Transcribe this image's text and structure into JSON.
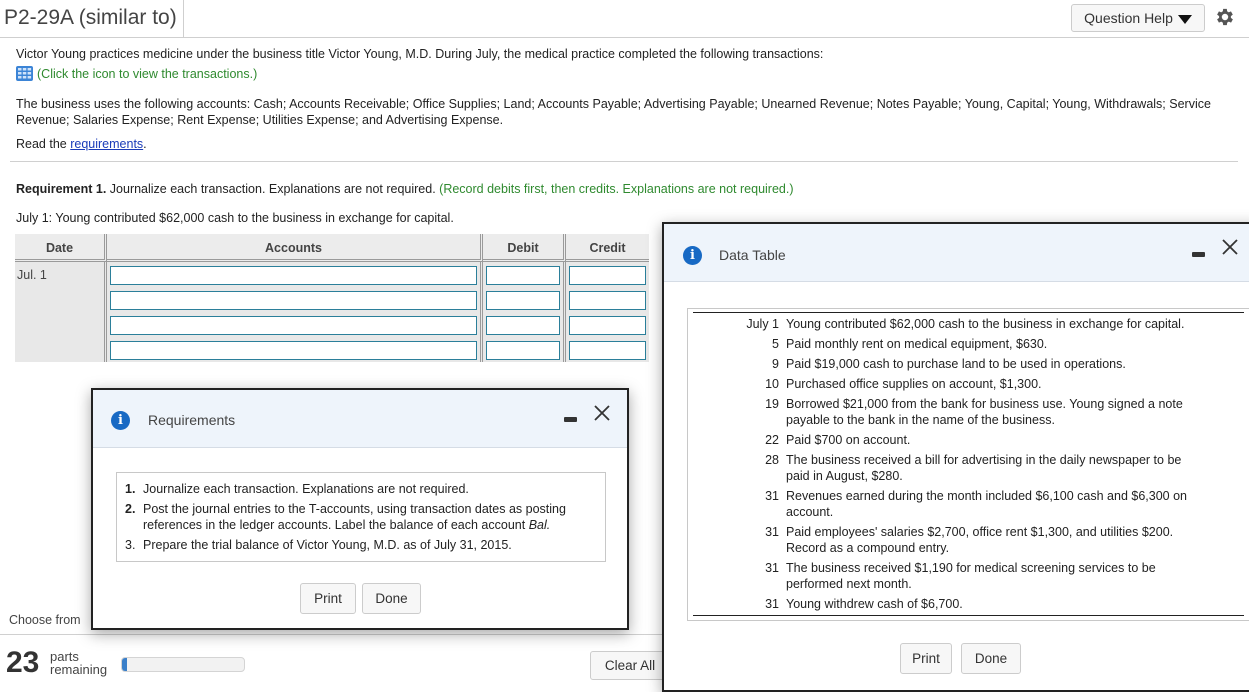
{
  "header": {
    "title": "P2-29A (similar to)",
    "question_help_label": "Question Help",
    "gear_icon": "gear-icon"
  },
  "intro": {
    "line1": "Victor Young practices medicine under the business title Victor Young, M.D. During July, the medical practice completed the following transactions:",
    "transactions_link": "(Click the icon to view the transactions.)",
    "accounts_text": "The business uses the following accounts: Cash; Accounts Receivable; Office Supplies; Land; Accounts Payable; Advertising Payable; Unearned Revenue; Notes Payable; Young, Capital; Young, Withdrawals; Service Revenue; Salaries Expense; Rent Expense; Utilities Expense; and Advertising Expense.",
    "read_prefix": "Read the ",
    "requirements_link": "requirements",
    "read_suffix": "."
  },
  "requirement1": {
    "label": "Requirement 1.",
    "text": " Journalize each transaction. Explanations are not required. ",
    "hint": "(Record debits first, then credits. Explanations are not required.)",
    "transaction": "July 1: Young contributed $62,000 cash to the business in exchange for capital."
  },
  "journal": {
    "headers": [
      "Date",
      "Accounts",
      "Debit",
      "Credit"
    ],
    "date": "Jul. 1",
    "rows": [
      {
        "account": "",
        "debit": "",
        "credit": ""
      },
      {
        "account": "",
        "debit": "",
        "credit": ""
      },
      {
        "account": "",
        "debit": "",
        "credit": ""
      },
      {
        "account": "",
        "debit": "",
        "credit": ""
      }
    ]
  },
  "footer": {
    "choose_from": "Choose from",
    "parts_count": "23",
    "parts_label_1": "parts",
    "parts_label_2": "remaining",
    "progress_fraction": 0.04,
    "clear_all_label": "Clear All"
  },
  "requirements_modal": {
    "title": "Requirements",
    "items": [
      {
        "num": "1.",
        "text": "Journalize each transaction. Explanations are not required."
      },
      {
        "num": "2.",
        "text": "Post the journal entries to the T-accounts, using transaction dates as posting references in the ledger accounts. Label the balance of each account ",
        "italic": "Bal."
      },
      {
        "num": "3.",
        "text": "Prepare the trial balance of Victor Young, M.D. as of July 31, 2015."
      }
    ],
    "print_label": "Print",
    "done_label": "Done"
  },
  "data_modal": {
    "title": "Data Table",
    "rows": [
      {
        "date": "July 1",
        "text": "Young contributed $62,000 cash to the business in exchange for capital."
      },
      {
        "date": "5",
        "text": "Paid monthly rent on medical equipment, $630."
      },
      {
        "date": "9",
        "text": "Paid $19,000 cash to purchase land to be used in operations."
      },
      {
        "date": "10",
        "text": "Purchased office supplies on account, $1,300."
      },
      {
        "date": "19",
        "text": "Borrowed $21,000 from the bank for business use. Young signed a note payable to the bank in the name of the business."
      },
      {
        "date": "22",
        "text": "Paid $700 on account."
      },
      {
        "date": "28",
        "text": "The business received a bill for advertising in the daily newspaper to be paid in August, $280."
      },
      {
        "date": "31",
        "text": "Revenues earned during the month included $6,100 cash and $6,300 on account."
      },
      {
        "date": "31",
        "text": "Paid employees' salaries $2,700, office rent $1,300, and utilities $200. Record as a compound entry."
      },
      {
        "date": "31",
        "text": "The business received $1,190 for medical screening services to be performed next month."
      },
      {
        "date": "31",
        "text": "Young withdrew cash of $6,700."
      }
    ],
    "print_label": "Print",
    "done_label": "Done"
  },
  "colors": {
    "info_blue": "#1769c4",
    "link_blue": "#1a3bb8",
    "hint_green": "#2f8a2f",
    "input_border": "#2b7f9a",
    "progress_fill": "#3a7fc9"
  }
}
